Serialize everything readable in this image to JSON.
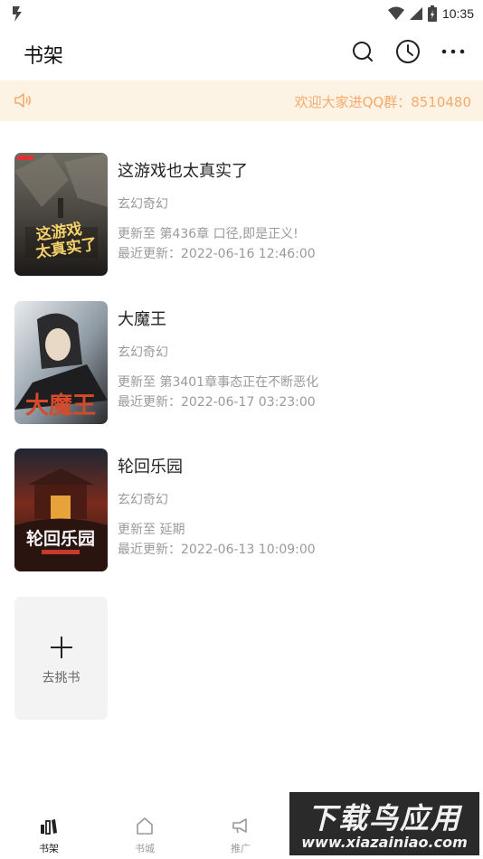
{
  "status_bar": {
    "time": "10:35"
  },
  "header": {
    "title": "书架"
  },
  "notice": {
    "text": "欢迎大家进QQ群：8510480"
  },
  "books": [
    {
      "title": "这游戏也太真实了",
      "genre": "玄幻奇幻",
      "latest": "更新至 第436章 口径,即是正义!",
      "updated": "最近更新：2022-06-16 12:46:00",
      "cover_text": "这游戏也太真实了"
    },
    {
      "title": "大魔王",
      "genre": "玄幻奇幻",
      "latest": "更新至 第3401章事态正在不断恶化",
      "updated": "最近更新：2022-06-17 03:23:00",
      "cover_text": "大魔王"
    },
    {
      "title": "轮回乐园",
      "genre": "玄幻奇幻",
      "latest": "更新至 延期",
      "updated": "最近更新：2022-06-13 10:09:00",
      "cover_text": "轮回乐园"
    }
  ],
  "add_book": {
    "label": "去挑书"
  },
  "bottom_nav": {
    "items": [
      {
        "label": "书架",
        "icon": "bookshelf-icon",
        "active": true
      },
      {
        "label": "书城",
        "icon": "home-icon",
        "active": false
      },
      {
        "label": "推广",
        "icon": "megaphone-icon",
        "active": false
      }
    ]
  },
  "watermark": {
    "title": "下载鸟应用",
    "url": "www.xiazainiao.com"
  },
  "colors": {
    "notice_bg": "#fdf3e4",
    "notice_text": "#f5a96a",
    "muted_text": "#9a9a9a"
  }
}
